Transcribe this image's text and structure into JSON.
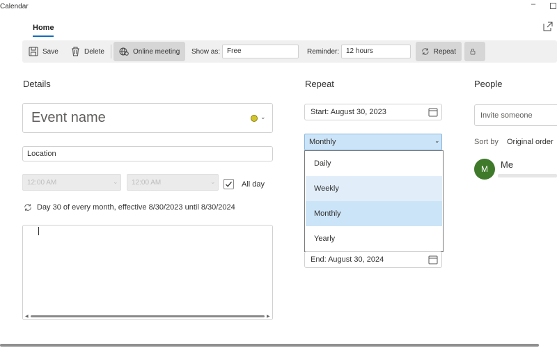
{
  "window": {
    "title": "Calendar",
    "minimize_glyph": "–"
  },
  "ribbon": {
    "active_tab": "Home"
  },
  "toolbar": {
    "save_label": "Save",
    "delete_label": "Delete",
    "online_meeting_label": "Online meeting",
    "show_as_label": "Show as:",
    "show_as_value": "Free",
    "reminder_label": "Reminder:",
    "reminder_value": "12 hours",
    "repeat_label": "Repeat"
  },
  "details": {
    "heading": "Details",
    "event_name_placeholder": "Event name",
    "category_color": "#d2c52a",
    "location_placeholder": "Location",
    "start_time": "12:00 AM",
    "end_time": "12:00 AM",
    "all_day_label": "All day",
    "all_day_checked": true,
    "recurrence_text": "Day 30 of every month, effective 8/30/2023 until 8/30/2024"
  },
  "repeat": {
    "heading": "Repeat",
    "start_text": "Start:  August 30, 2023",
    "frequency_selected": "Monthly",
    "options": [
      "Daily",
      "Weekly",
      "Monthly",
      "Yearly"
    ],
    "end_text": "End:  August 30, 2024"
  },
  "people": {
    "heading": "People",
    "invite_placeholder": "Invite someone",
    "sort_label": "Sort by",
    "sort_value": "Original order",
    "person_initial": "M",
    "person_name": "Me",
    "avatar_color": "#3f7a2b"
  },
  "colors": {
    "accent": "#0f6cbd",
    "dropdown_hover": "#e1eefa",
    "dropdown_selected": "#cce4f7"
  }
}
